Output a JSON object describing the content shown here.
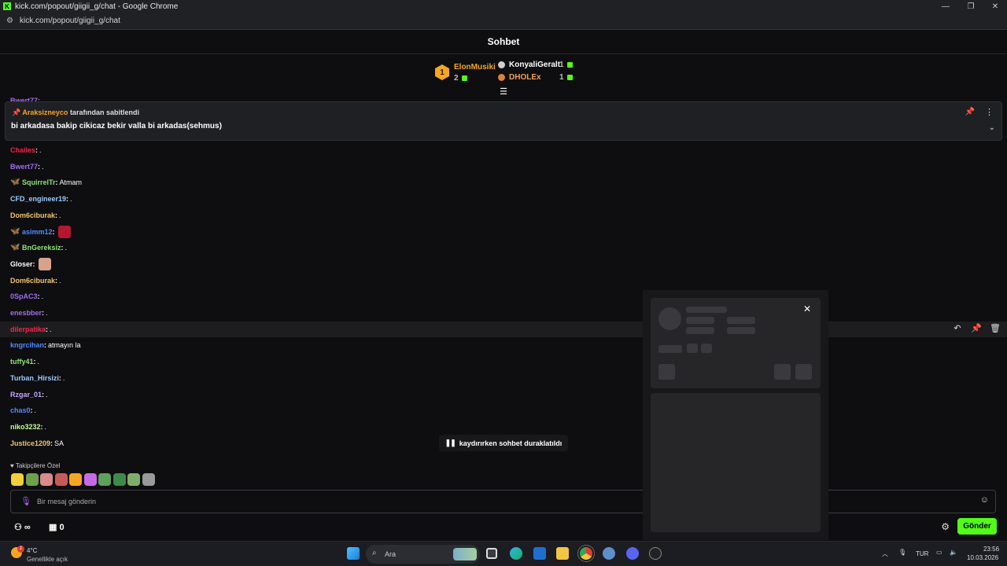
{
  "window": {
    "title": "kick.com/popout/giigii_g/chat - Google Chrome",
    "url": "kick.com/popout/giigii_g/chat"
  },
  "chat": {
    "title": "Sohbet",
    "leaderboard": {
      "first": {
        "rank": "1",
        "name": "ElonMusiki",
        "count": "2"
      },
      "others": [
        {
          "name": "KonyaliGeralt",
          "count": "1",
          "color": "#ffffff",
          "medal_color": "#cfcfcf"
        },
        {
          "name": "DHOLEx",
          "count": "1",
          "color": "#f0a25b",
          "medal_color": "#d7843c"
        }
      ]
    },
    "pinned": {
      "user": "Araksizneyco",
      "suffix": "tarafından sabitlendi",
      "message": "bi arkadasa bakip cikicaz bekir valla bi arkadas(sehmus)"
    },
    "partial_top_user": "Bwert77: .",
    "messages": [
      {
        "user": "Chailes",
        "color": "#ef2b4b",
        "badge": "",
        "text": "."
      },
      {
        "user": "Bwert77",
        "color": "#a36bf2",
        "badge": "",
        "text": "."
      },
      {
        "user": "SquirrelTr",
        "color": "#8fe27a",
        "badge": "🦋",
        "text": "Atmam"
      },
      {
        "user": "CFD_engineer19",
        "color": "#9ecbff",
        "badge": "",
        "text": "."
      },
      {
        "user": "Dom6ciburak",
        "color": "#f3c46a",
        "badge": "",
        "text": "."
      },
      {
        "user": "asimm12",
        "color": "#4f8bff",
        "badge": "🦋",
        "text": "",
        "emote": "#b3182f"
      },
      {
        "user": "BnGereksiz",
        "color": "#8fe27a",
        "badge": "🦋",
        "text": "."
      },
      {
        "user": "Gloser",
        "color": "#ffffff",
        "badge": "",
        "text": "",
        "emote": "#d8a38c"
      },
      {
        "user": "Dom6ciburak",
        "color": "#f3c46a",
        "badge": "",
        "text": "."
      },
      {
        "user": "0SpAC3",
        "color": "#a36bf2",
        "badge": "",
        "text": "."
      },
      {
        "user": "enesbber",
        "color": "#a36bf2",
        "badge": "",
        "text": "."
      },
      {
        "user": "dilerpatika",
        "color": "#ef2b4b",
        "badge": "",
        "text": ".",
        "highlight": true
      },
      {
        "user": "kngrcihan",
        "color": "#4f8bff",
        "badge": "",
        "text": "atmayın la"
      },
      {
        "user": "tuffy41",
        "color": "#8fe27a",
        "badge": "",
        "text": "."
      },
      {
        "user": "Turban_Hirsizi",
        "color": "#9ecbff",
        "badge": "",
        "text": "."
      },
      {
        "user": "Rzgar_01",
        "color": "#c6a6ff",
        "badge": "",
        "text": "."
      },
      {
        "user": "chas0",
        "color": "#4f8bff",
        "badge": "",
        "text": "."
      },
      {
        "user": "niko3232",
        "color": "#c6ff8f",
        "badge": "",
        "text": "."
      },
      {
        "user": "Justice1209",
        "color": "#f3c46a",
        "badge": "",
        "text": "SA"
      }
    ],
    "paused_label": "kaydırırken sohbet duraklatıldı",
    "follower_label": "Takipçilere Özel",
    "emotes": [
      "#f3d03a",
      "#6fa04a",
      "#d98a8a",
      "#c85a5a",
      "#f5a623",
      "#c86ae6",
      "#5fa05a",
      "#3f8a4a",
      "#7fae6a",
      "#9a9a9a"
    ],
    "input_placeholder": "Bir mesaj gönderin",
    "infinity_label": "∞",
    "store_count": "0",
    "send_label": "Gönder"
  },
  "taskbar": {
    "temp": "4°C",
    "weather": "Genellikle açık",
    "weather_badge": "1",
    "search_label": "Ara",
    "lang": "TUR",
    "time": "23:56",
    "date": "10.03.2026"
  },
  "colors": {
    "accent": "#53fc18",
    "gold": "#f5a623"
  }
}
